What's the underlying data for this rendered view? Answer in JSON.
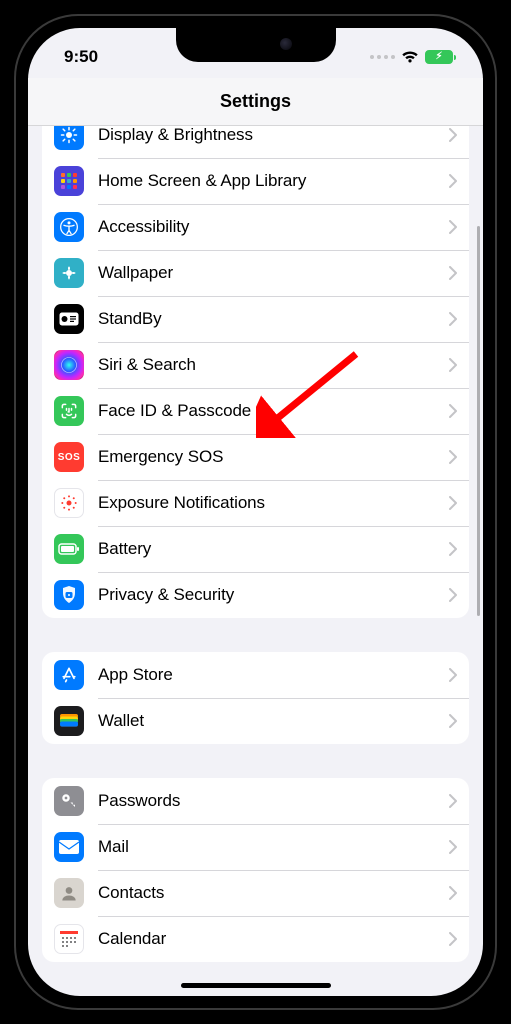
{
  "status": {
    "time": "9:50"
  },
  "nav": {
    "title": "Settings"
  },
  "groups": [
    {
      "cells": [
        {
          "key": "display",
          "label": "Display & Brightness"
        },
        {
          "key": "homescreen",
          "label": "Home Screen & App Library"
        },
        {
          "key": "accessibility",
          "label": "Accessibility"
        },
        {
          "key": "wallpaper",
          "label": "Wallpaper"
        },
        {
          "key": "standby",
          "label": "StandBy"
        },
        {
          "key": "siri",
          "label": "Siri & Search"
        },
        {
          "key": "faceid",
          "label": "Face ID & Passcode"
        },
        {
          "key": "sos",
          "label": "Emergency SOS",
          "icon_text": "SOS"
        },
        {
          "key": "exposure",
          "label": "Exposure Notifications"
        },
        {
          "key": "battery",
          "label": "Battery"
        },
        {
          "key": "privacy",
          "label": "Privacy & Security"
        }
      ]
    },
    {
      "cells": [
        {
          "key": "appstore",
          "label": "App Store"
        },
        {
          "key": "wallet",
          "label": "Wallet"
        }
      ]
    },
    {
      "cells": [
        {
          "key": "passwords",
          "label": "Passwords"
        },
        {
          "key": "mail",
          "label": "Mail"
        },
        {
          "key": "contacts",
          "label": "Contacts"
        },
        {
          "key": "calendar",
          "label": "Calendar"
        }
      ]
    }
  ]
}
